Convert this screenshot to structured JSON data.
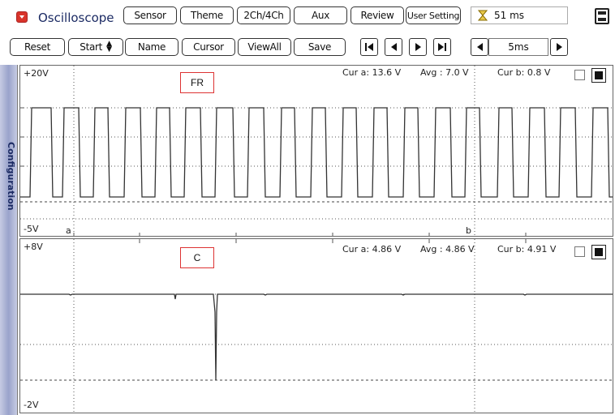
{
  "header": {
    "title": "Oscilloscope",
    "buttons": [
      "Sensor",
      "Theme",
      "2Ch/4Ch",
      "Aux",
      "Review",
      "User Setting"
    ],
    "time_display": "51 ms"
  },
  "toolbar": {
    "reset": "Reset",
    "start": "Start",
    "name": "Name",
    "cursor": "Cursor",
    "viewall": "ViewAll",
    "save": "Save",
    "timebase": "5ms"
  },
  "sidebar": {
    "label": "Configuration"
  },
  "channels": [
    {
      "label": "FR",
      "vmax": "+20V",
      "vmin": "-5V",
      "cur_a": "Cur a: 13.6 V",
      "avg": "Avg  : 7.0 V",
      "cur_b": "Cur b: 0.8 V",
      "cursor_a_label": "a",
      "cursor_b_label": "b"
    },
    {
      "label": "C",
      "vmax": "+8V",
      "vmin": "-2V",
      "cur_a": "Cur a: 4.86 V",
      "avg": "Avg  : 4.86 V",
      "cur_b": "Cur b: 4.91 V"
    }
  ]
}
